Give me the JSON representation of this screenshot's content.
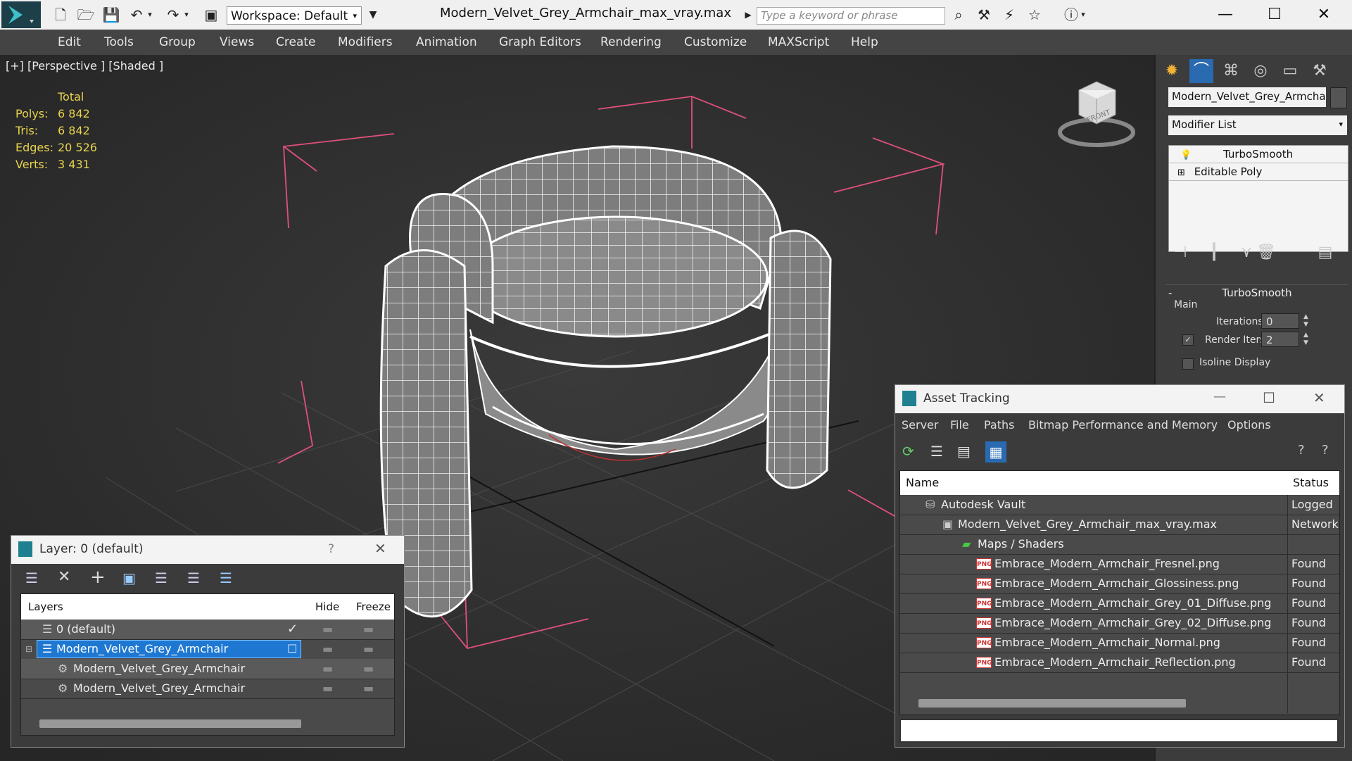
{
  "title_bar": {
    "workspace_label": "Workspace: Default",
    "file_title": "Modern_Velvet_Grey_Armchair_max_vray.max",
    "search_placeholder": "Type a keyword or phrase"
  },
  "menu": {
    "items": [
      "Edit",
      "Tools",
      "Group",
      "Views",
      "Create",
      "Modifiers",
      "Animation",
      "Graph Editors",
      "Rendering",
      "Customize",
      "MAXScript",
      "Help"
    ]
  },
  "viewport": {
    "label": "[+] [Perspective ] [Shaded ]",
    "stats": {
      "header": "Total",
      "rows": [
        {
          "label": "Polys:",
          "value": "6 842"
        },
        {
          "label": "Tris:",
          "value": "6 842"
        },
        {
          "label": "Edges:",
          "value": "20 526"
        },
        {
          "label": "Verts:",
          "value": "3 431"
        }
      ]
    },
    "viewcube_face": "FRONT"
  },
  "command_panel": {
    "object_name": "Modern_Velvet_Grey_Armchair",
    "modifier_list_label": "Modifier List",
    "stack": [
      "TurboSmooth",
      "Editable Poly"
    ],
    "rollout_title": "TurboSmooth",
    "group_label": "Main",
    "iterations_label": "Iterations:",
    "iterations_value": "0",
    "render_iters_label": "Render Iters:",
    "render_iters_value": "2",
    "isoline_label": "Isoline Display"
  },
  "layer_window": {
    "title": "Layer: 0 (default)",
    "help": "?",
    "columns": [
      "Layers",
      "Hide",
      "Freeze"
    ],
    "rows": [
      {
        "name": "0 (default)"
      },
      {
        "name": "Modern_Velvet_Grey_Armchair"
      },
      {
        "name": "Modern_Velvet_Grey_Armchair"
      },
      {
        "name": "Modern_Velvet_Grey_Armchair"
      }
    ]
  },
  "asset_window": {
    "title": "Asset Tracking",
    "menu": [
      "Server",
      "File",
      "Paths",
      "Bitmap Performance and Memory",
      "Options"
    ],
    "columns": [
      "Name",
      "Status"
    ],
    "rows": [
      {
        "name": "Autodesk Vault",
        "status": "Logged"
      },
      {
        "name": "Modern_Velvet_Grey_Armchair_max_vray.max",
        "status": "Network"
      },
      {
        "name": "Maps / Shaders",
        "status": ""
      },
      {
        "name": "Embrace_Modern_Armchair_Fresnel.png",
        "status": "Found"
      },
      {
        "name": "Embrace_Modern_Armchair_Glossiness.png",
        "status": "Found"
      },
      {
        "name": "Embrace_Modern_Armchair_Grey_01_Diffuse.png",
        "status": "Found"
      },
      {
        "name": "Embrace_Modern_Armchair_Grey_02_Diffuse.png",
        "status": "Found"
      },
      {
        "name": "Embrace_Modern_Armchair_Normal.png",
        "status": "Found"
      },
      {
        "name": "Embrace_Modern_Armchair_Reflection.png",
        "status": "Found"
      }
    ],
    "png_badge": "PNG"
  },
  "colors": {
    "accent_blue": "#1e78d2",
    "stats_yellow": "#e8d44d",
    "bbox_pink": "#e0507a"
  }
}
